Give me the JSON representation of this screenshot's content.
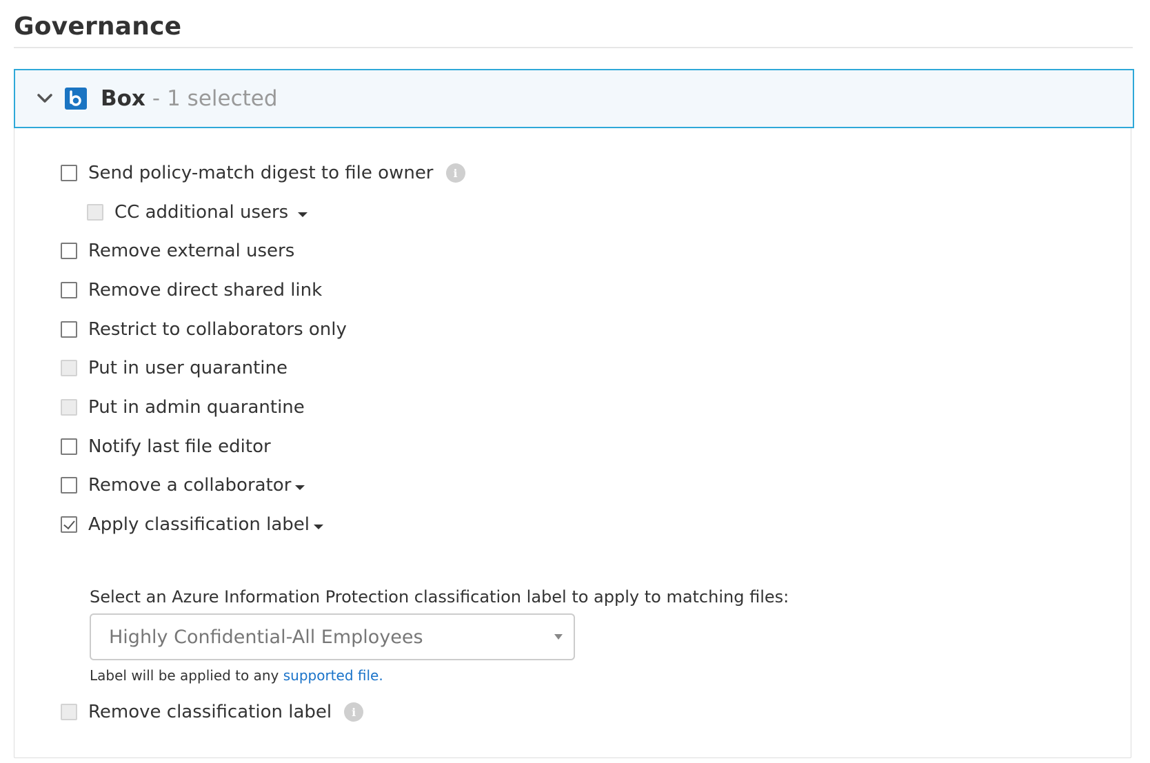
{
  "section": {
    "title": "Governance"
  },
  "app_panel": {
    "name": "Box",
    "separator": "-",
    "selected_text": "1 selected",
    "icons": {
      "toggle": "chevron-down-icon",
      "logo": "box-logo-icon"
    },
    "colors": {
      "header_border": "#2ea8d8",
      "header_background": "#f3f8fc",
      "logo": "#1a74c2"
    }
  },
  "options": [
    {
      "label": "Send policy-match digest to file owner",
      "checked": false,
      "enabled": true,
      "has_info": true
    },
    {
      "label": "CC additional users",
      "checked": false,
      "enabled": false,
      "has_dropdown": true,
      "indented": true
    },
    {
      "label": "Remove external users",
      "checked": false,
      "enabled": true
    },
    {
      "label": "Remove direct shared link",
      "checked": false,
      "enabled": true
    },
    {
      "label": "Restrict to collaborators only",
      "checked": false,
      "enabled": true
    },
    {
      "label": "Put in user quarantine",
      "checked": false,
      "enabled": false
    },
    {
      "label": "Put in admin quarantine",
      "checked": false,
      "enabled": false
    },
    {
      "label": "Notify last file editor",
      "checked": false,
      "enabled": true
    },
    {
      "label": "Remove a collaborator",
      "checked": false,
      "enabled": true,
      "has_dropdown": true
    },
    {
      "label": "Apply classification label",
      "checked": true,
      "enabled": true,
      "has_dropdown": true
    },
    {
      "label": "Remove classification label",
      "checked": false,
      "enabled": false,
      "has_info": true
    }
  ],
  "classification": {
    "prompt": "Select an Azure Information Protection classification label to apply to matching files:",
    "selected_value": "Highly Confidential-All Employees",
    "help_prefix": "Label will be applied to any ",
    "help_link": "supported file.",
    "link_color": "#1a73c9"
  },
  "info_glyph": "i"
}
